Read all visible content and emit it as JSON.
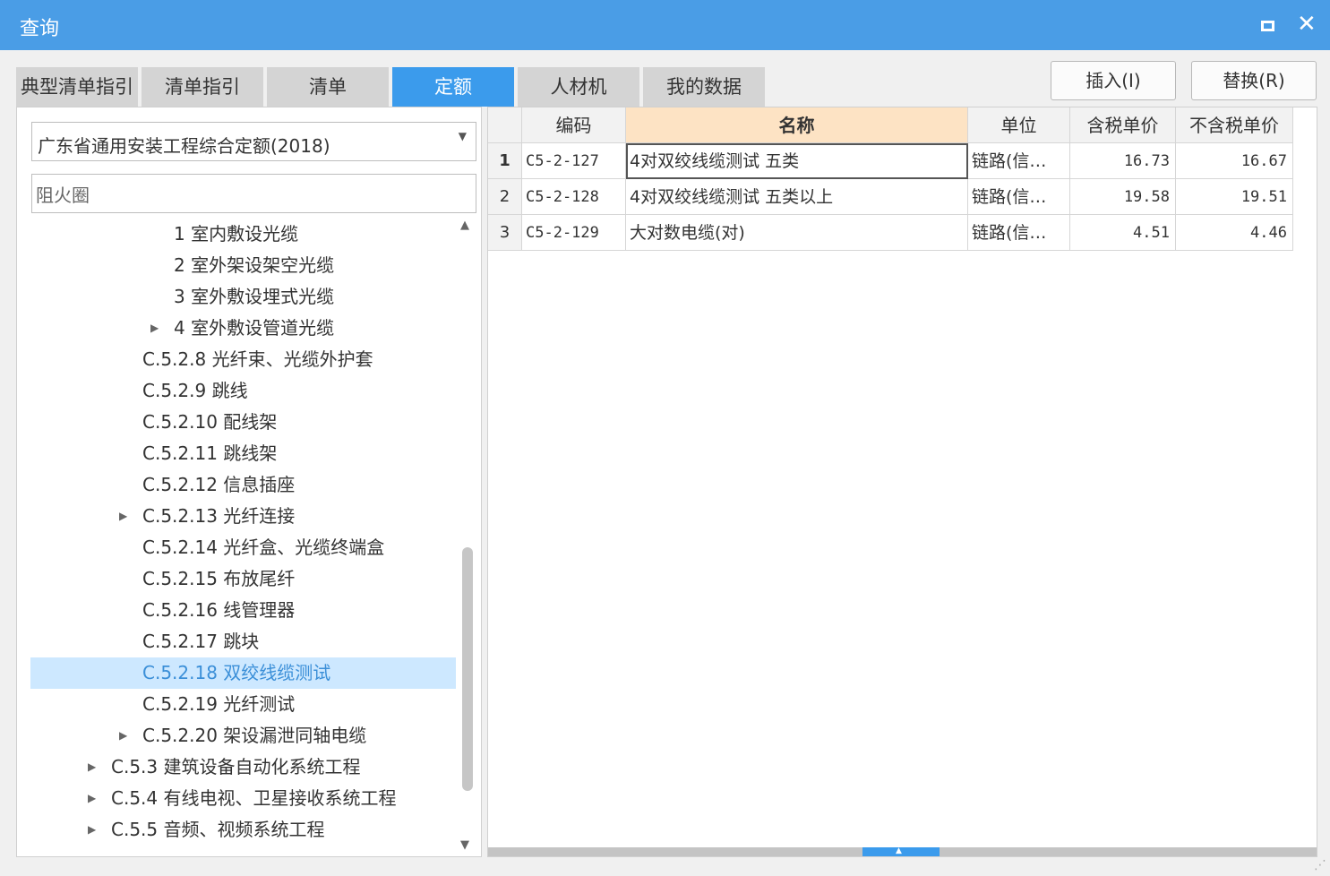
{
  "window": {
    "title": "查询"
  },
  "tabs": [
    {
      "label": "典型清单指引",
      "active": false
    },
    {
      "label": "清单指引",
      "active": false
    },
    {
      "label": "清单",
      "active": false
    },
    {
      "label": "定额",
      "active": true
    },
    {
      "label": "人材机",
      "active": false
    },
    {
      "label": "我的数据",
      "active": false
    }
  ],
  "buttons": {
    "insert": "插入(I)",
    "replace": "替换(R)"
  },
  "library": {
    "selected": "广东省通用安装工程综合定额(2018)"
  },
  "search": {
    "value": "阻火圈"
  },
  "tree": [
    {
      "label": "1 室内敷设光缆",
      "expandable": false,
      "selected": false
    },
    {
      "label": "2 室外架设架空光缆",
      "expandable": false,
      "selected": false
    },
    {
      "label": "3 室外敷设埋式光缆",
      "expandable": false,
      "selected": false
    },
    {
      "label": "4 室外敷设管道光缆",
      "expandable": true,
      "selected": false
    },
    {
      "label": "C.5.2.8 光纤束、光缆外护套",
      "expandable": false,
      "selected": false
    },
    {
      "label": "C.5.2.9 跳线",
      "expandable": false,
      "selected": false
    },
    {
      "label": "C.5.2.10 配线架",
      "expandable": false,
      "selected": false
    },
    {
      "label": "C.5.2.11 跳线架",
      "expandable": false,
      "selected": false
    },
    {
      "label": "C.5.2.12 信息插座",
      "expandable": false,
      "selected": false
    },
    {
      "label": "C.5.2.13 光纤连接",
      "expandable": true,
      "selected": false
    },
    {
      "label": "C.5.2.14 光纤盒、光缆终端盒",
      "expandable": false,
      "selected": false
    },
    {
      "label": "C.5.2.15 布放尾纤",
      "expandable": false,
      "selected": false
    },
    {
      "label": "C.5.2.16 线管理器",
      "expandable": false,
      "selected": false
    },
    {
      "label": "C.5.2.17 跳块",
      "expandable": false,
      "selected": false
    },
    {
      "label": "C.5.2.18 双绞线缆测试",
      "expandable": false,
      "selected": true
    },
    {
      "label": "C.5.2.19 光纤测试",
      "expandable": false,
      "selected": false
    },
    {
      "label": "C.5.2.20 架设漏泄同轴电缆",
      "expandable": true,
      "selected": false
    },
    {
      "label": "C.5.3 建筑设备自动化系统工程",
      "expandable": true,
      "selected": false
    },
    {
      "label": "C.5.4 有线电视、卫星接收系统工程",
      "expandable": true,
      "selected": false
    },
    {
      "label": "C.5.5 音频、视频系统工程",
      "expandable": true,
      "selected": false
    }
  ],
  "table": {
    "headers": [
      "编码",
      "名称",
      "单位",
      "含税单价",
      "不含税单价"
    ],
    "rows": [
      {
        "n": "1",
        "code": "C5-2-127",
        "name": "4对双绞线缆测试 五类",
        "unit": "链路(信…",
        "tax_price": "16.73",
        "notax_price": "16.67"
      },
      {
        "n": "2",
        "code": "C5-2-128",
        "name": "4对双绞线缆测试 五类以上",
        "unit": "链路(信…",
        "tax_price": "19.58",
        "notax_price": "19.51"
      },
      {
        "n": "3",
        "code": "C5-2-129",
        "name": "大对数电缆(对)",
        "unit": "链路(信…",
        "tax_price": "4.51",
        "notax_price": "4.46"
      }
    ]
  },
  "colors": {
    "titlebar": "#4a9de6",
    "tab_active": "#3b9bec",
    "tree_selected_bg": "#cde8ff",
    "header_highlight": "#fde3c4"
  }
}
